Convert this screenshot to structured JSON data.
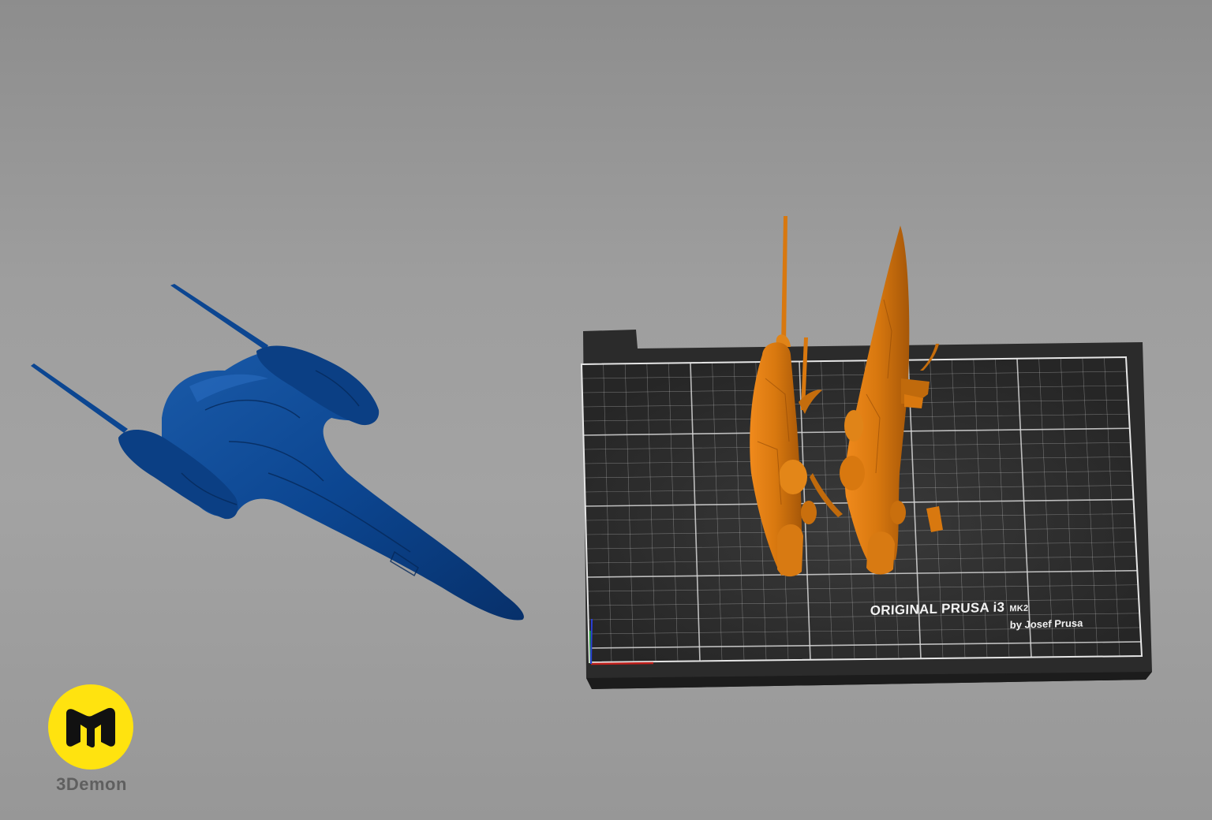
{
  "scene": {
    "background_top": "#8d8d8d",
    "background_bottom": "#979797"
  },
  "models": {
    "preview_model_color": "#0c4691",
    "printable_parts_color": "#d8780f"
  },
  "print_bed": {
    "title": "ORIGINAL PRUSA i3",
    "model_suffix": "MK2",
    "subtitle": "by Josef Prusa",
    "surface_color": "#2e2e2e",
    "grid_color": "#d8d8d8"
  },
  "axes": {
    "x_color": "#c0201c",
    "y_color": "#1e9a2a",
    "z_color": "#2a3fd8"
  },
  "watermark": {
    "brand_name": "3Demon",
    "icon": "3demon-logo-icon",
    "color": "#ffe30f"
  }
}
